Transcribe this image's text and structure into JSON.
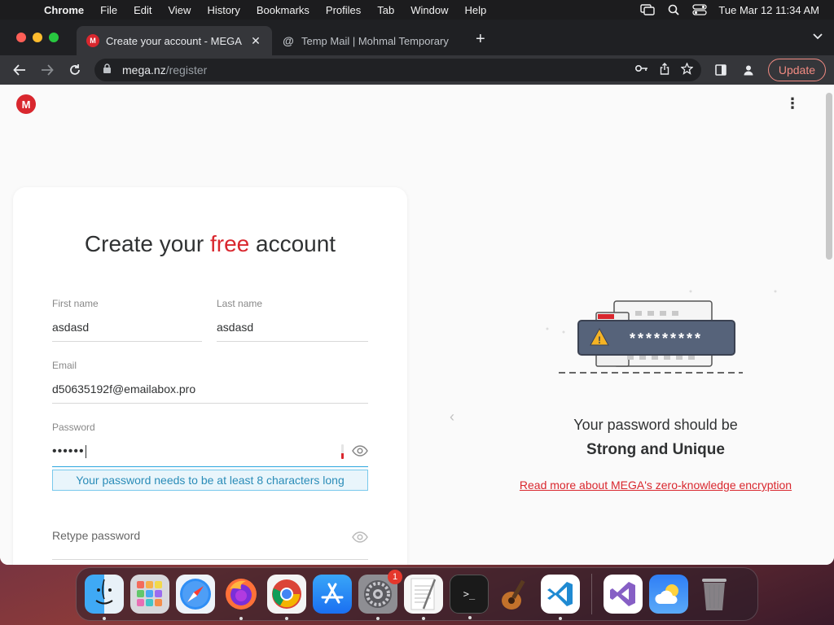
{
  "menubar": {
    "apple_glyph": "",
    "items": [
      "Chrome",
      "File",
      "Edit",
      "View",
      "History",
      "Bookmarks",
      "Profiles",
      "Tab",
      "Window",
      "Help"
    ],
    "clock": "Tue Mar 12  11:34 AM"
  },
  "browser": {
    "tabs": [
      {
        "title": "Create your account - MEGA",
        "favicon": "mega-icon",
        "active": true
      },
      {
        "title": "Temp Mail | Mohmal Temporary",
        "favicon": "at-icon",
        "active": false
      }
    ],
    "url_host": "mega.nz",
    "url_path": "/register",
    "update_label": "Update"
  },
  "page": {
    "logo_letter": "M",
    "heading_pre": "Create your ",
    "heading_accent": "free",
    "heading_post": " account",
    "fields": {
      "first_name": {
        "label": "First name",
        "value": "asdasd"
      },
      "last_name": {
        "label": "Last name",
        "value": "asdasd"
      },
      "email": {
        "label": "Email",
        "value": "d50635192f@emailabox.pro"
      },
      "password": {
        "label": "Password",
        "value": "••••••"
      },
      "retype": {
        "placeholder": "Retype password"
      }
    },
    "password_hint": "Your password needs to be at least 8 characters long",
    "slide": {
      "masked_password": "*********",
      "title": "Your password should be",
      "strong": "Strong and Unique",
      "link": "Read more about MEGA's zero-knowledge encryption"
    }
  },
  "dock": {
    "items": [
      "finder-icon",
      "launchpad-icon",
      "safari-icon",
      "firefox-icon",
      "chrome-icon",
      "app-store-icon",
      "system-settings-icon",
      "textedit-icon",
      "terminal-icon",
      "instruments-icon",
      "vscode-icon",
      "visual-studio-icon",
      "weather-icon",
      "trash-icon"
    ],
    "settings_badge": "1"
  },
  "colors": {
    "mega_red": "#d9272e",
    "focus_blue": "#2ba6de",
    "hint_bg": "#e9f5fb"
  }
}
